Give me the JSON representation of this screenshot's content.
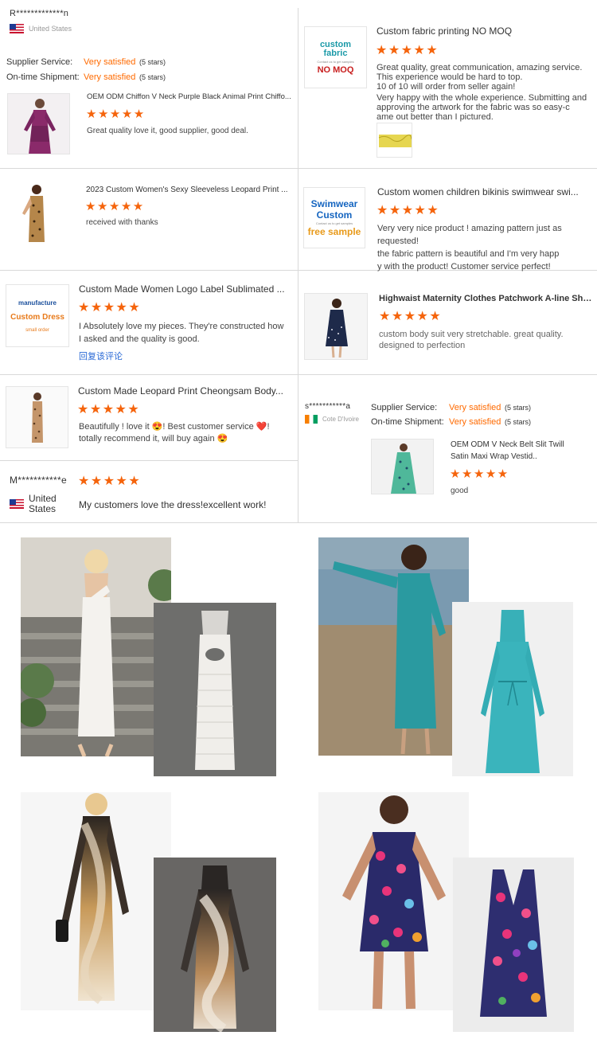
{
  "colors": {
    "accent": "#ff6a00",
    "star": "#f5640c",
    "divider": "#d9d9d9"
  },
  "reviews": {
    "r1": {
      "name": "R*************n",
      "country": "United States",
      "supplier_label": "Supplier Service:",
      "supplier_value": "Very satisfied",
      "supplier_stars": "(5 stars)",
      "shipment_label": "On-time Shipment:",
      "shipment_value": "Very satisfied",
      "shipment_stars": "(5 stars)",
      "product": "OEM ODM Chiffon V Neck Purple Black Animal Print Chiffo...",
      "stars": "★★★★★",
      "comment": "Great quality love it, good supplier, good deal."
    },
    "r2": {
      "logo_line1": "custom",
      "logo_line2": "fabric",
      "logo_small": "Contact us to get samples",
      "logo_line3": "NO MOQ",
      "product": "Custom fabric printing NO MOQ",
      "stars": "★★★★★",
      "comment1": "Great quality, great communication, amazing service.",
      "comment2": "This experience would be hard to top.",
      "comment3": "10 of 10 will order from seller again!",
      "comment4": "Very happy with  the whole experience. Submitting and",
      "comment5": "approving the artwork for the fabric was so easy-c",
      "comment6": "ame out better than I pictured."
    },
    "r3": {
      "product": "2023 Custom Women's Sexy Sleeveless Leopard Print ...",
      "stars": "★★★★★",
      "comment": "received with thanks"
    },
    "r4": {
      "logo_line1": "Swimwear",
      "logo_line2": "Custom",
      "logo_small": "Contact us to get samples",
      "logo_line3": "free sample",
      "product": "Custom women children bikinis swimwear swi...",
      "stars": "★★★★★",
      "comment1": "Very very nice product ! amazing pattern just as requested!",
      "comment2": "the fabric pattern is beautiful and I'm very happ",
      "comment3": "y with the product! Customer service perfect!"
    },
    "r5": {
      "logo_line1": "manufacture",
      "logo_line2": "Custom Dress",
      "logo_line3": "small order",
      "product": "Custom Made Women Logo Label Sublimated ...",
      "stars": "★★★★★",
      "comment1": "I Absolutely love my pieces. They're constructed how",
      "comment2": "I asked and the quality is good.",
      "reply": "回复该评论"
    },
    "r6": {
      "product": "Highwaist Maternity Clothes Patchwork A-line Shirt D...",
      "stars": "★★★★★",
      "comment1": "custom body suit very stretchable. great quality.",
      "comment2": "designed to perfection"
    },
    "r7": {
      "product": "Custom Made Leopard Print Cheongsam Body...",
      "stars": "★★★★★",
      "comment1": "Beautifully ! love it 😍! Best customer service ❤️!",
      "comment2": "totally recommend it, will buy again 😍"
    },
    "r8": {
      "name": "s***********a",
      "country": "Cote D'Ivoire",
      "supplier_label": "Supplier Service:",
      "supplier_value": "Very satisfied",
      "supplier_stars": "(5 stars)",
      "shipment_label": "On-time Shipment:",
      "shipment_value": "Very satisfied",
      "shipment_stars": "(5 stars)",
      "product1": "OEM ODM V Neck Belt Slit Twill",
      "product2": "Satin Maxi Wrap Vestid..",
      "stars": "★★★★★",
      "comment": "good"
    },
    "r9": {
      "name": "M***********e",
      "country": "United States",
      "stars": "★★★★★",
      "comment": "My customers love the dress!excellent work!"
    }
  }
}
